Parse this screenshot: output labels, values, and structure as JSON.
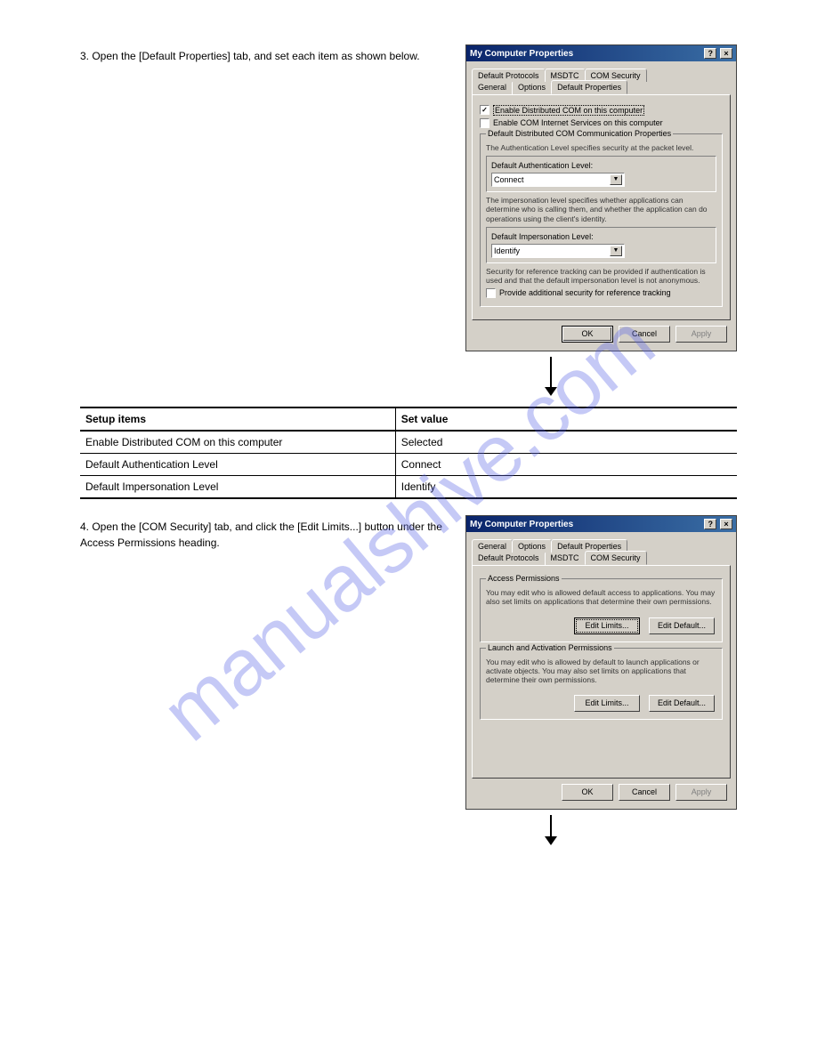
{
  "intro": {
    "step": "3. Open the [Default Properties] tab, and set each item as shown below."
  },
  "dialog1": {
    "title": "My Computer Properties",
    "help": "?",
    "close": "×",
    "tabs_row1": [
      "Default Protocols",
      "MSDTC",
      "COM Security"
    ],
    "tabs_row2": [
      "General",
      "Options",
      "Default Properties"
    ],
    "chk1": "Enable Distributed COM on this computer",
    "chk2": "Enable COM Internet Services on this computer",
    "group_title": "Default Distributed COM Communication Properties",
    "note1": "The Authentication Level specifies security at the packet level.",
    "sub1_label": "Default Authentication Level:",
    "sub1_value": "Connect",
    "note2": "The impersonation level specifies whether applications can determine who is calling them, and whether the application can do operations using the client's identity.",
    "sub2_label": "Default Impersonation Level:",
    "sub2_value": "Identify",
    "note3": "Security for reference tracking can be provided if authentication is used and that the default impersonation level is not anonymous.",
    "chk3": "Provide additional security for reference tracking",
    "ok": "OK",
    "cancel": "Cancel",
    "apply": "Apply"
  },
  "table": {
    "h1": "Setup items",
    "h2": "Set value",
    "r1c1": "Enable Distributed COM on this computer",
    "r1c2": "Selected",
    "r2c1": "Default Authentication Level",
    "r2c2": "Connect",
    "r3c1": "Default Impersonation Level",
    "r3c2": "Identify"
  },
  "step4": {
    "text": "4. Open the [COM Security] tab, and click the [Edit Limits...] button under the Access Permissions heading."
  },
  "dialog2": {
    "title": "My Computer Properties",
    "help": "?",
    "close": "×",
    "tabs_row1": [
      "General",
      "Options",
      "Default Properties"
    ],
    "tabs_row2": [
      "Default Protocols",
      "MSDTC",
      "COM Security"
    ],
    "grp1_title": "Access Permissions",
    "grp1_text": "You may edit who is allowed default access to applications. You may also set limits on applications that determine their own permissions.",
    "btn_editlimits": "Edit Limits...",
    "btn_editdefault": "Edit Default...",
    "grp2_title": "Launch and Activation Permissions",
    "grp2_text": "You may edit who is allowed by default to launch applications or activate objects. You may also set limits on applications that determine their own permissions.",
    "ok": "OK",
    "cancel": "Cancel",
    "apply": "Apply"
  }
}
